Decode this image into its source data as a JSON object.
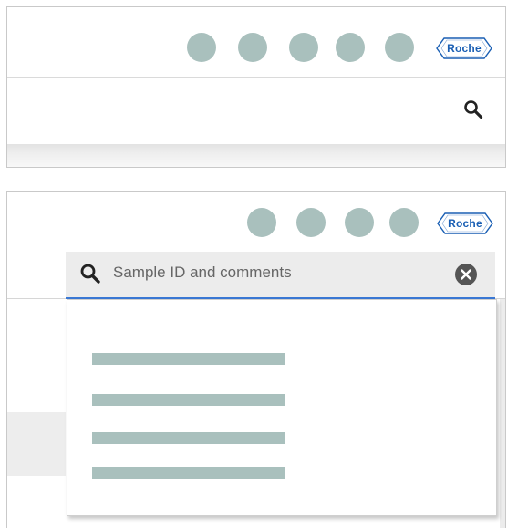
{
  "top_panel": {
    "status_dots": [
      "status-dot-1",
      "status-dot-2",
      "status-dot-3",
      "status-dot-4",
      "status-dot-5"
    ],
    "logo": "Roche",
    "search_icon": "search-icon"
  },
  "bottom_panel": {
    "status_dots": [
      "status-dot-1",
      "status-dot-2",
      "status-dot-3",
      "status-dot-4"
    ],
    "logo": "Roche",
    "search": {
      "icon": "search-icon",
      "placeholder": "Sample ID and comments",
      "clear_icon": "close-icon"
    },
    "results": [
      "result-1",
      "result-2",
      "result-3",
      "result-4"
    ]
  },
  "colors": {
    "dot": "#a9c0bd",
    "placeholder_line": "#a9c0bd",
    "accent": "#3a78d4",
    "logo": "#1a5fb4"
  }
}
